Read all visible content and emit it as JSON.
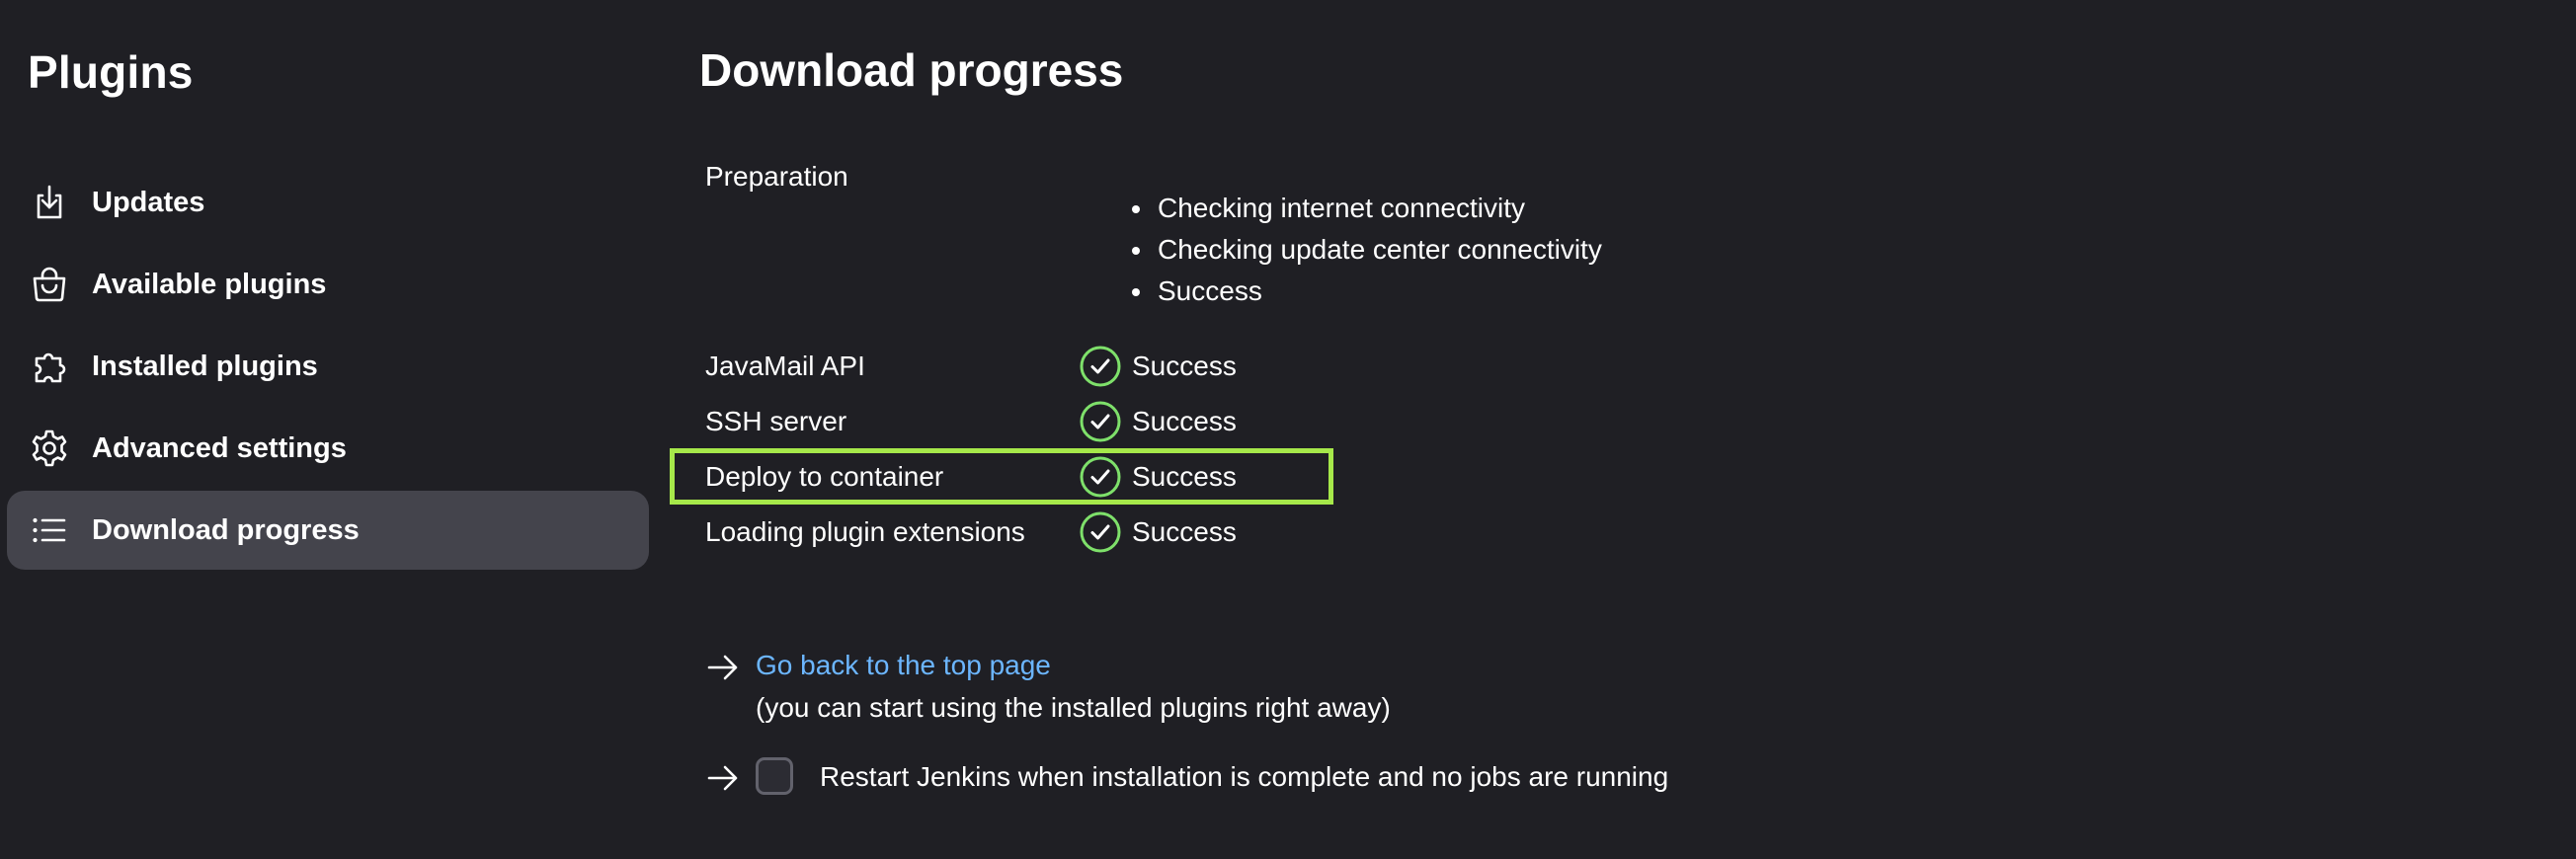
{
  "sidebar": {
    "title": "Plugins",
    "items": [
      {
        "label": "Updates",
        "icon": "download-icon"
      },
      {
        "label": "Available plugins",
        "icon": "shopping-bag-icon"
      },
      {
        "label": "Installed plugins",
        "icon": "puzzle-icon"
      },
      {
        "label": "Advanced settings",
        "icon": "gear-icon"
      },
      {
        "label": "Download progress",
        "icon": "list-icon",
        "active": true
      }
    ]
  },
  "main": {
    "title": "Download progress",
    "preparation": {
      "label": "Preparation",
      "steps": [
        "Checking internet connectivity",
        "Checking update center connectivity",
        "Success"
      ]
    },
    "statuses": [
      {
        "name": "JavaMail API",
        "status": "Success"
      },
      {
        "name": "SSH server",
        "status": "Success"
      },
      {
        "name": "Deploy to container",
        "status": "Success"
      },
      {
        "name": "Loading plugin extensions",
        "status": "Success"
      }
    ],
    "back_link": "Go back to the top page",
    "back_note": "(you can start using the installed plugins right away)",
    "restart_label": "Restart Jenkins when installation is complete and no jobs are running",
    "restart_checked": false
  },
  "colors": {
    "background": "#1f1f24",
    "active_nav": "#44444c",
    "success": "#7ee06a",
    "link": "#6cb6ff",
    "highlight": "#a6e84a"
  }
}
